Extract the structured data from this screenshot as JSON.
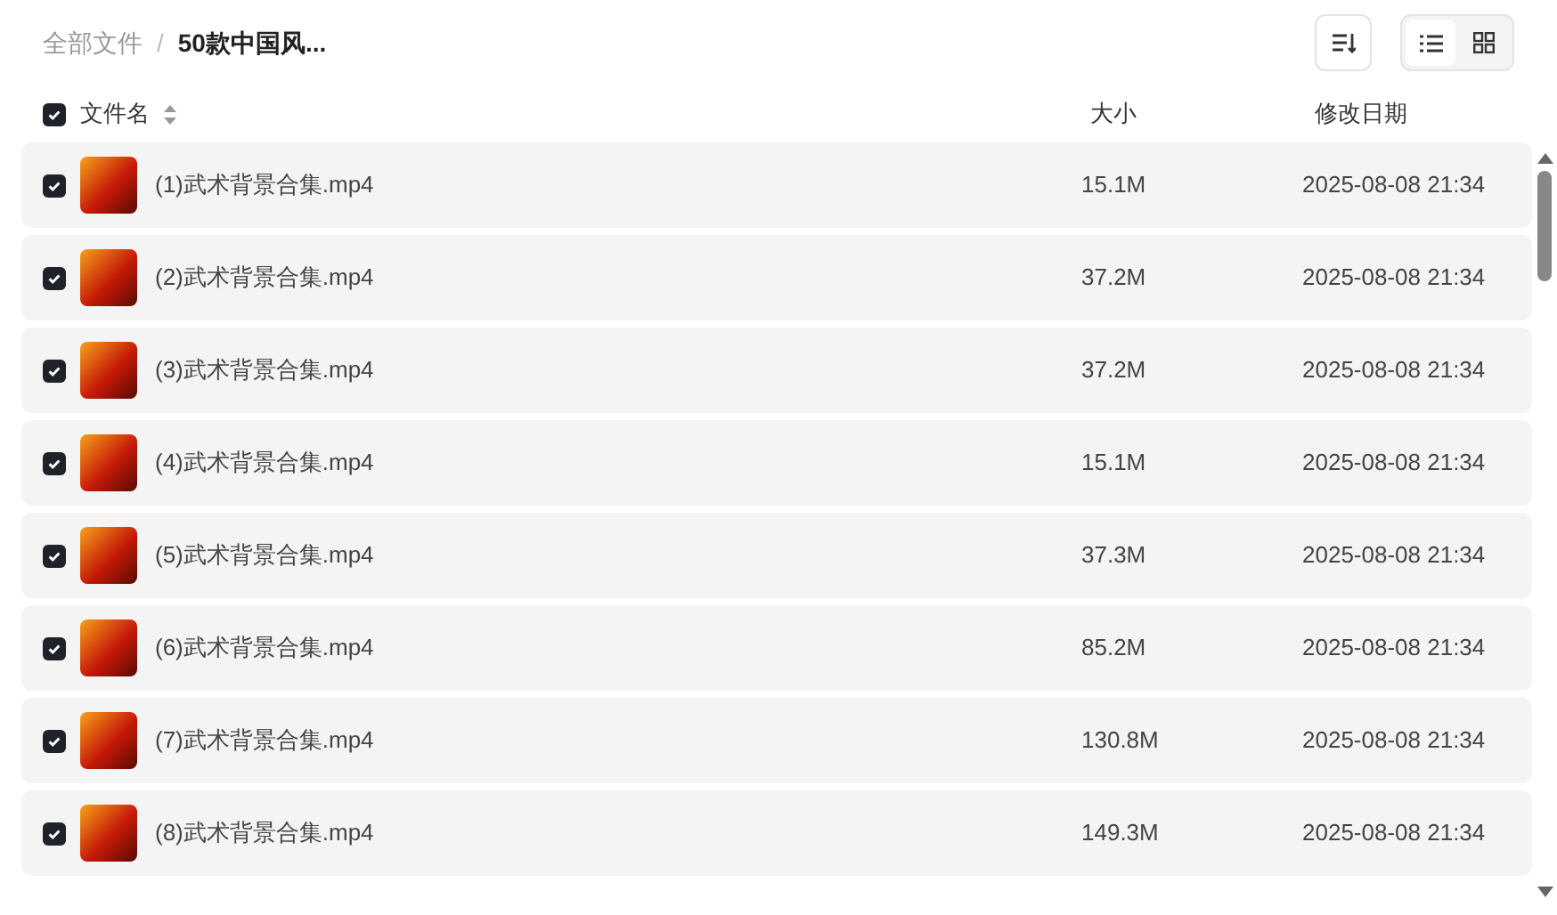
{
  "breadcrumb_separator": "/",
  "breadcrumb": [
    {
      "label": "全部文件",
      "current": false
    },
    {
      "label": "50款中国风...",
      "current": true
    }
  ],
  "view_modes": [
    {
      "kind": "list",
      "selected": true
    },
    {
      "kind": "grid",
      "selected": false
    }
  ],
  "table": {
    "all_checked": true,
    "columns": [
      "文件名",
      "大小",
      "修改日期"
    ],
    "rows": [
      {
        "checked": true,
        "name": "(1)武术背景合集.mp4",
        "size": "15.1M",
        "date": "2025-08-08 21:34"
      },
      {
        "checked": true,
        "name": "(2)武术背景合集.mp4",
        "size": "37.2M",
        "date": "2025-08-08 21:34"
      },
      {
        "checked": true,
        "name": "(3)武术背景合集.mp4",
        "size": "37.2M",
        "date": "2025-08-08 21:34"
      },
      {
        "checked": true,
        "name": "(4)武术背景合集.mp4",
        "size": "15.1M",
        "date": "2025-08-08 21:34"
      },
      {
        "checked": true,
        "name": "(5)武术背景合集.mp4",
        "size": "37.3M",
        "date": "2025-08-08 21:34"
      },
      {
        "checked": true,
        "name": "(6)武术背景合集.mp4",
        "size": "85.2M",
        "date": "2025-08-08 21:34"
      },
      {
        "checked": true,
        "name": "(7)武术背景合集.mp4",
        "size": "130.8M",
        "date": "2025-08-08 21:34"
      },
      {
        "checked": true,
        "name": "(8)武术背景合集.mp4",
        "size": "149.3M",
        "date": "2025-08-08 21:34"
      }
    ]
  }
}
